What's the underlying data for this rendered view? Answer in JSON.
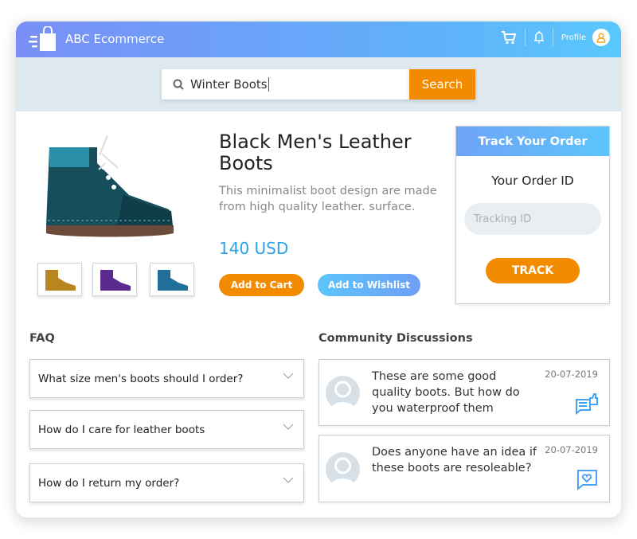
{
  "header": {
    "brand": "ABC Ecommerce",
    "profile_label": "Profile",
    "icons": [
      "shopping-bag-logo",
      "cart-icon",
      "bell-icon",
      "user-icon"
    ]
  },
  "search": {
    "value": "Winter Boots",
    "button": "Search"
  },
  "product": {
    "title": "Black Men's Leather Boots",
    "description": "This minimalist boot design are made from high quality leather. surface.",
    "price": "140 USD",
    "add_to_cart": "Add to Cart",
    "add_to_wishlist": "Add to Wishlist",
    "thumbnail_colors": [
      "#b8861e",
      "#5a2a8e",
      "#1f6f9a"
    ]
  },
  "track": {
    "title": "Track Your Order",
    "label": "Your Order ID",
    "placeholder": "Tracking ID",
    "button": "TRACK"
  },
  "faq": {
    "title": "FAQ",
    "items": [
      "What size men's boots should I order?",
      "How do I care for leather boots",
      "How do I return my order?"
    ]
  },
  "community": {
    "title": "Community Discussions",
    "posts": [
      {
        "text": "These are some good quality boots. But how do you waterproof them",
        "date": "20-07-2019",
        "icon": "thumbs-up-comment-icon"
      },
      {
        "text": "Does anyone have an idea if these boots are resoleable?",
        "date": "20-07-2019",
        "icon": "heart-comment-icon"
      }
    ]
  },
  "colors": {
    "accent_orange": "#f38b00",
    "accent_blue": "#2aa3e6",
    "header_start": "#7a8ff6",
    "header_end": "#5ac8fc"
  }
}
